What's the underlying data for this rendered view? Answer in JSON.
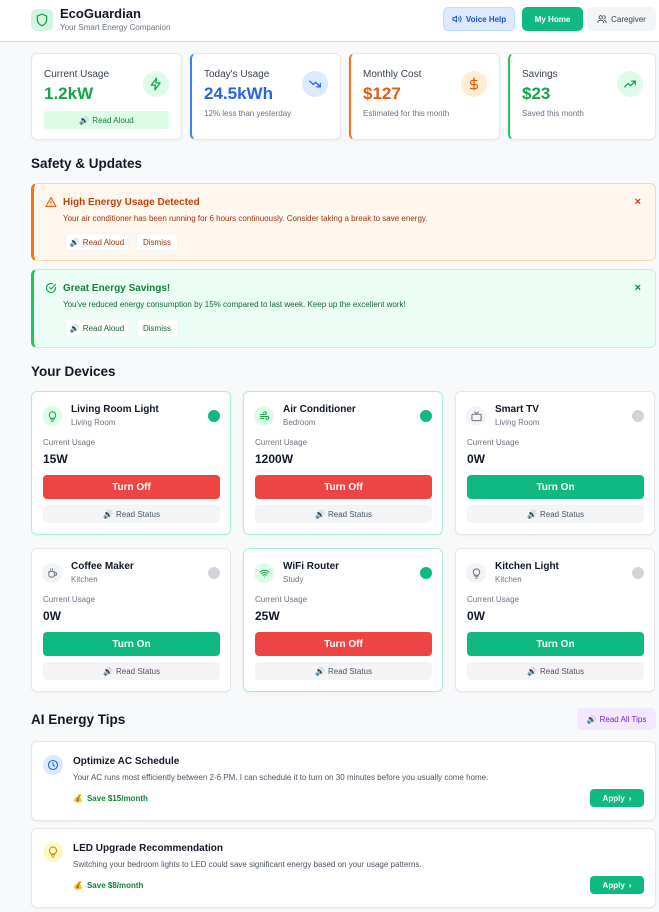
{
  "header": {
    "brand": "EcoGuardian",
    "tagline": "Your Smart Energy Companion",
    "voice_help": "Voice Help",
    "my_home": "My Home",
    "caregiver": "Caregiver"
  },
  "stats": [
    {
      "label": "Current Usage",
      "value": "1.2kW",
      "action": "Read Aloud",
      "icon": "bolt-icon",
      "color": "#16a34a"
    },
    {
      "label": "Today's Usage",
      "value": "24.5kWh",
      "sub": "12% less than yesterday",
      "icon": "trending-down-icon",
      "color": "#2563eb"
    },
    {
      "label": "Monthly Cost",
      "value": "$127",
      "sub": "Estimated for this month",
      "icon": "dollar-icon",
      "color": "#ea580c"
    },
    {
      "label": "Savings",
      "value": "$23",
      "sub": "Saved this month",
      "icon": "trending-up-icon",
      "color": "#16a34a"
    }
  ],
  "sections": {
    "safety": "Safety & Updates",
    "devices": "Your Devices",
    "tips": "AI Energy Tips"
  },
  "alerts": [
    {
      "title": "High Energy Usage Detected",
      "message": "Your air conditioner has been running for 6 hours continuously. Consider taking a break to save energy.",
      "read": "Read Aloud",
      "dismiss": "Dismiss",
      "close": "×",
      "type": "warning"
    },
    {
      "title": "Great Energy Savings!",
      "message": "You've reduced energy consumption by 15% compared to last week. Keep up the excellent work!",
      "read": "Read Aloud",
      "dismiss": "Dismiss",
      "close": "×",
      "type": "success"
    }
  ],
  "device_common": {
    "usage_label": "Current Usage",
    "read_status": "Read Status"
  },
  "devices": [
    {
      "name": "Living Room Light",
      "room": "Living Room",
      "usage": "15W",
      "on": true,
      "action": "Turn Off",
      "icon": "lightbulb-icon"
    },
    {
      "name": "Air Conditioner",
      "room": "Bedroom",
      "usage": "1200W",
      "on": true,
      "action": "Turn Off",
      "icon": "wind-icon"
    },
    {
      "name": "Smart TV",
      "room": "Living Room",
      "usage": "0W",
      "on": false,
      "action": "Turn On",
      "icon": "tv-icon"
    },
    {
      "name": "Coffee Maker",
      "room": "Kitchen",
      "usage": "0W",
      "on": false,
      "action": "Turn On",
      "icon": "coffee-icon"
    },
    {
      "name": "WiFi Router",
      "room": "Study",
      "usage": "25W",
      "on": true,
      "action": "Turn Off",
      "icon": "wifi-icon"
    },
    {
      "name": "Kitchen Light",
      "room": "Kitchen",
      "usage": "0W",
      "on": false,
      "action": "Turn On",
      "icon": "lightbulb-icon"
    }
  ],
  "tips_header": {
    "read_all": "Read All Tips"
  },
  "tips": [
    {
      "title": "Optimize AC Schedule",
      "message": "Your AC runs most efficiently between 2-6 PM. I can schedule it to turn on 30 minutes before you usually come home.",
      "saving": "Save $15/month",
      "apply": "Apply",
      "icon": "clock-icon"
    },
    {
      "title": "LED Upgrade Recommendation",
      "message": "Switching your bedroom lights to LED could save significant energy based on your usage patterns.",
      "saving": "Save $8/month",
      "apply": "Apply",
      "icon": "lightbulb-icon"
    }
  ],
  "colors": {
    "accent": "#10b981",
    "danger": "#ef4444",
    "warning": "#f97316",
    "tip_accent": "#7e22ce"
  }
}
